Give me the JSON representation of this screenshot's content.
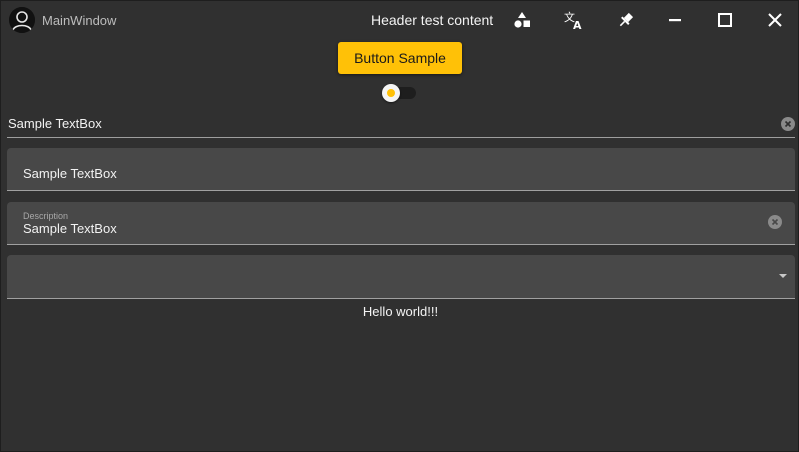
{
  "window": {
    "title": "MainWindow",
    "header_content": "Header test content"
  },
  "titlebar": {
    "buttons": [
      {
        "name": "shapes",
        "icon": "shapes-icon"
      },
      {
        "name": "translate",
        "icon": "translate-icon"
      },
      {
        "name": "pin",
        "icon": "pin-icon"
      },
      {
        "name": "minimize",
        "icon": "minimize-icon"
      },
      {
        "name": "maximize",
        "icon": "maximize-icon"
      },
      {
        "name": "close",
        "icon": "close-icon"
      }
    ]
  },
  "main": {
    "button_label": "Button Sample",
    "toggle_on": false,
    "textbox_plain": {
      "value": "Sample TextBox"
    },
    "textbox_filled": {
      "value": "Sample TextBox"
    },
    "textbox_described": {
      "hint": "Description",
      "value": "Sample TextBox"
    },
    "combo": {
      "selected": ""
    },
    "hello_text": "Hello world!!!"
  },
  "colors": {
    "background": "#303030",
    "accent": "#ffc107",
    "field_fill": "#484848",
    "text": "#ffffff"
  }
}
